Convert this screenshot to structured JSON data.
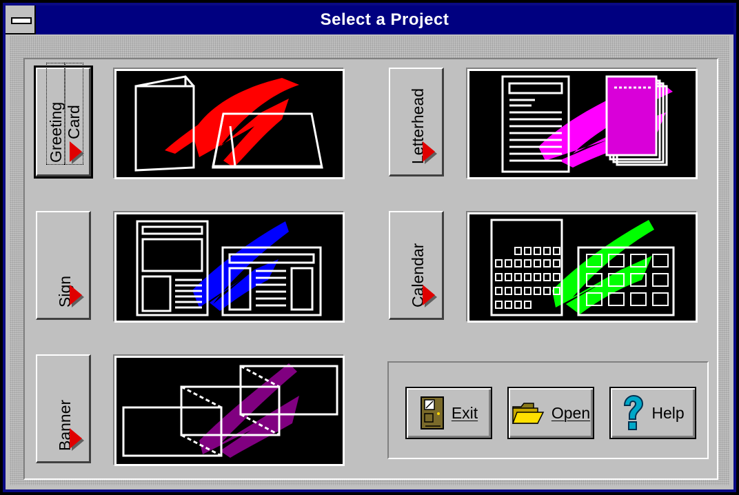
{
  "window": {
    "title": "Select a Project"
  },
  "projects": {
    "greeting_card": {
      "line1": "Greeting",
      "line2": "Card",
      "mnemonic": "G",
      "accent": "#ff0000"
    },
    "letterhead": {
      "line1": "Letterhead",
      "mnemonic": "L",
      "accent": "#ff00ff"
    },
    "sign": {
      "line1": "Sign",
      "mnemonic": "S",
      "accent": "#0000ff"
    },
    "calendar": {
      "line1": "Calendar",
      "mnemonic": "C",
      "accent": "#00ff00"
    },
    "banner": {
      "line1": "Banner",
      "mnemonic": "B",
      "accent": "#800080"
    }
  },
  "actions": {
    "exit": {
      "label": "Exit",
      "icon": "door-icon"
    },
    "open": {
      "label": "Open",
      "icon": "folder-icon"
    },
    "help": {
      "label": "Help",
      "icon": "question-mark-icon"
    }
  },
  "colors": {
    "title_bar": "#000080",
    "face": "#c0c0c0",
    "arrow": "#e00000"
  }
}
